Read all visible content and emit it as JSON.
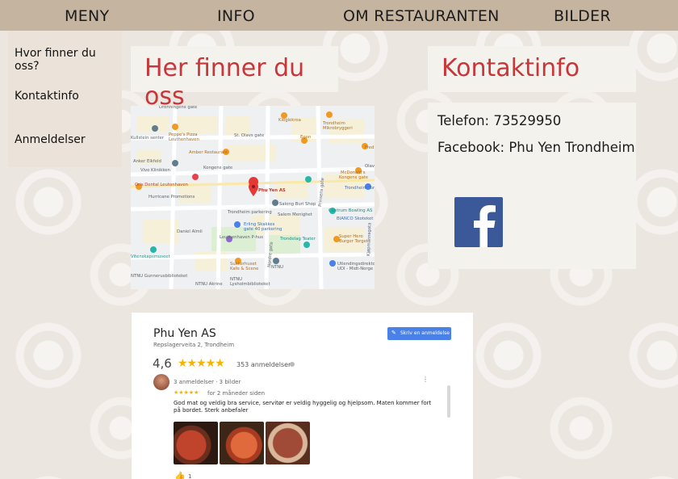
{
  "nav": {
    "items": [
      "MENY",
      "INFO",
      "OM RESTAURANTEN",
      "BILDER"
    ]
  },
  "dropdown": {
    "items": [
      "Hvor finner du oss?",
      "Kontaktinfo",
      "Anmeldelser"
    ]
  },
  "location": {
    "heading": "Her finner du oss"
  },
  "map": {
    "labels": [
      "Dronningens gate",
      "Kieglekroa",
      "Trondheim Mikrobryggeri",
      "Peppe's Pizza Leuthenhaven",
      "St. Olavs gate",
      "Egon",
      "Fred",
      "Kullstein senter",
      "Amber Restaurant",
      "Anker Elkfeld",
      "Vivo Klinikken",
      "Kongens gate",
      "Olav",
      "Oris Dental Leutonhaven",
      "McDonald's Kongens gate",
      "Hurricane Promotions",
      "Phu Yen AS",
      "Trondheim Torg",
      "Salong Buri Shop",
      "Trondheim parkering",
      "Salem Menighet",
      "Centrum Bowling AS",
      "BIANCO Skoteket",
      "Daniel Almli",
      "Erling Skakkes gate 40 parkering",
      "Leuthenhaven P-hus",
      "Super Hero Burger Torget",
      "Trondelag Teater",
      "Vitenskapsmuseet",
      "Sukkerhuset Kafe & Scene",
      "NTNU Gunnerusbiblioteket",
      "NTNU Lysholmbiblioteket",
      "Utlendingsdirektoratet UDI - Midt-Norge",
      "NTNU Akrine",
      "Prinsens gate",
      "Nordre gate",
      "Kjøpmannsgata"
    ]
  },
  "contact": {
    "heading": "Kontaktinfo",
    "phone": "Telefon: 73529950",
    "facebook": "Facebook: Phu Yen Trondheim",
    "facebook_icon": "facebook-icon",
    "facebook_color": "#3b5998"
  },
  "review": {
    "business_name": "Phu Yen AS",
    "address": "Repslagerveita 2, Trondheim",
    "rating": "4,6",
    "stars": "★★★★★",
    "review_count": "353 anmeldelser",
    "write_button": "Skriv en anmeldelse",
    "reviewer_meta": "3 anmeldelser · 3 bilder",
    "review_stars": "★★★★★",
    "review_time": "for 2 måneder siden",
    "review_text": "God mat og veldig bra service, servitør er veldig hyggelig og hjelpsom.  Maten kommer fort på bordet. Sterk anbefaler",
    "like_count": "1"
  },
  "colors": {
    "accent": "#c8363a",
    "navbar": "#c4b4a0",
    "panel": "#f3f2ec",
    "google_blue": "#4a81e8",
    "star": "#f4b400"
  }
}
